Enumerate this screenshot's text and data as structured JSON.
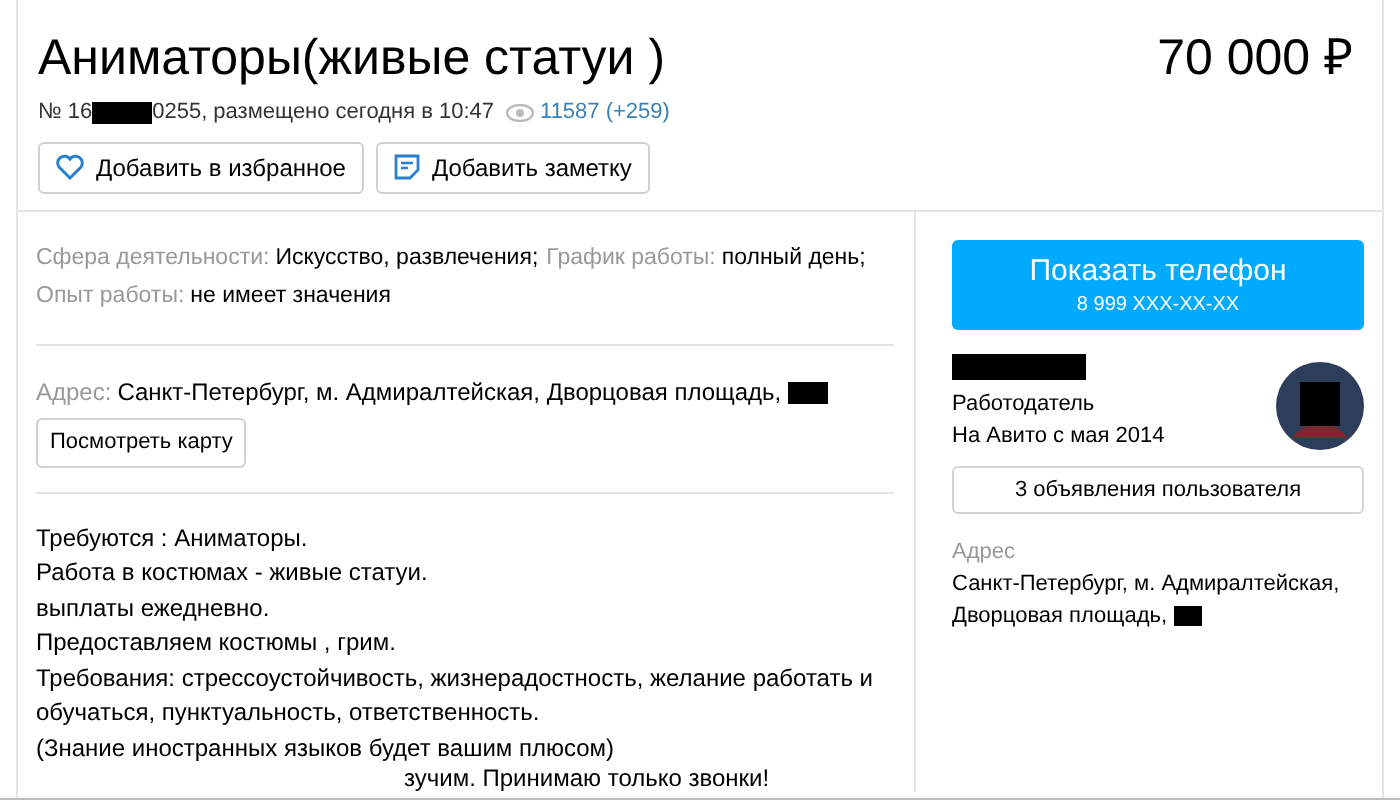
{
  "title": "Аниматоры(живые статуи )",
  "price": "70 000 ₽",
  "meta": {
    "number_prefix": "№ 16",
    "number_suffix": "0255, размещено сегодня в 10:47",
    "views": "11587 (+259)"
  },
  "actions": [
    {
      "kind": "favorite",
      "label": "Добавить в избранное"
    },
    {
      "kind": "note",
      "label": "Добавить заметку"
    }
  ],
  "params": [
    {
      "label": "Сфера деятельности:",
      "value": "Искусство, развлечения;"
    },
    {
      "label": "График работы:",
      "value": "полный день;"
    },
    {
      "label": "Опыт работы:",
      "value": "не имеет значения"
    }
  ],
  "address": {
    "label": "Адрес:",
    "value": "Санкт-Петербург, м. Адмиралтейская, Дворцовая площадь,",
    "map_button": "Посмотреть карту"
  },
  "description": [
    "Требуются : Аниматоры.",
    "Работа в костюмах - живые статуи.",
    "выплаты ежедневно.",
    "Предоставляем костюмы , грим.",
    "Требования: стрессоустойчивость, жизнерадостность, желание работать и обучаться, пунктуальность, ответственность.",
    "(Знание иностранных языков будет вашим плюсом)",
    "зучим. Принимаю только звонки!"
  ],
  "seller": {
    "phone_title": "Показать телефон",
    "phone_number": "8 999 XXX-XX-XX",
    "role": "Работодатель",
    "since": "На Авито с мая 2014",
    "listings_button": "3 объявления пользователя",
    "address_label": "Адрес",
    "address_lines": [
      "Санкт-Петербург, м. Адмиралтейская,",
      "Дворцовая площадь,"
    ]
  }
}
